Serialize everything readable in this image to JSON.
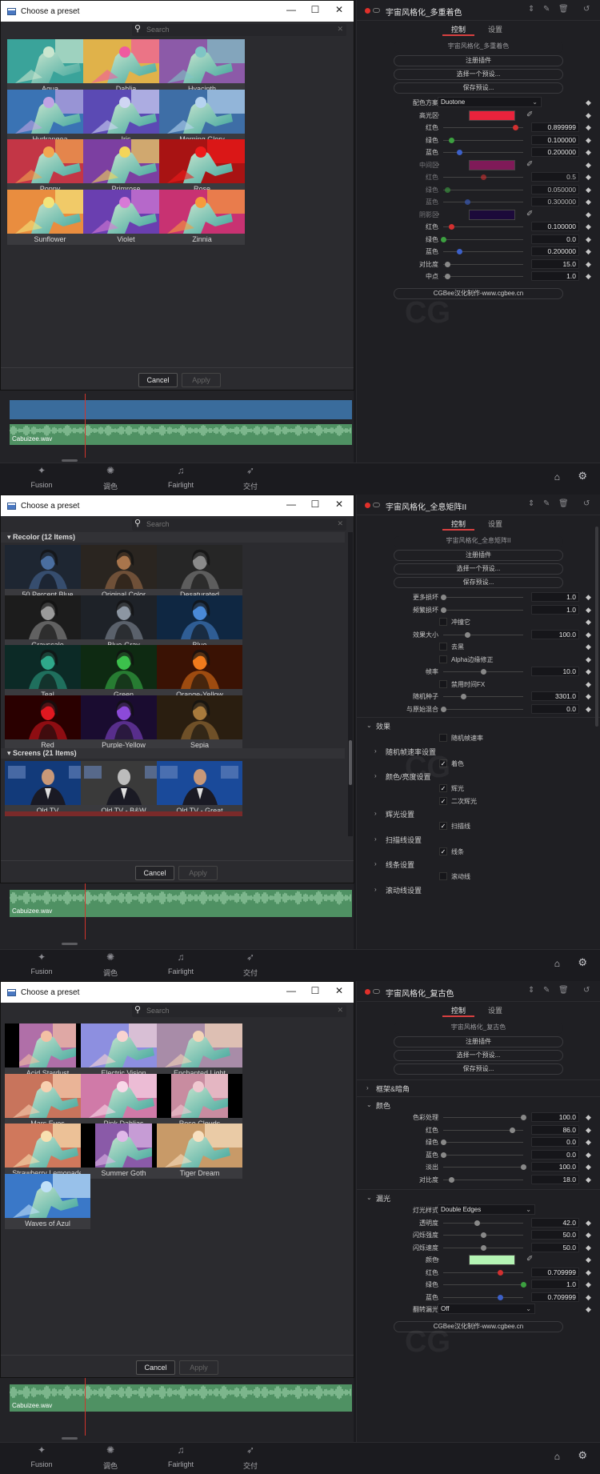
{
  "window_controls": {
    "minimize": "—",
    "maximize": "☐",
    "close": "✕"
  },
  "bottom_nav": {
    "fusion": "Fusion",
    "color": "调色",
    "fairlight": "Fairlight",
    "deliver": "交付"
  },
  "audio_clip_name": "Cabuizee.wav",
  "inspector_tabs": {
    "control": "控制",
    "settings": "设置"
  },
  "colors": {
    "accent_red": "#d84040",
    "panel_bg": "#1f1f23",
    "dialog_bg": "#2b2b2f",
    "audio_green": "#4f9163"
  },
  "icons": [
    "app-window-icon",
    "search-icon",
    "clear-icon",
    "minimize-icon",
    "maximize-icon",
    "close-icon",
    "fusion-icon",
    "color-icon",
    "fairlight-icon",
    "deliver-icon",
    "home-icon",
    "settings-gear-icon",
    "keyframe-diamond-icon",
    "eyedropper-icon",
    "chevron-right-icon",
    "chevron-down-icon",
    "undo-icon"
  ],
  "screens": [
    {
      "dialog": {
        "title": "Choose a preset",
        "search_placeholder": "Search",
        "cancel": "Cancel",
        "apply": "Apply"
      },
      "presets": [
        {
          "label": "Aqua",
          "c1": "#3aa39a",
          "c2": "#c9e6cf"
        },
        {
          "label": "Dahlia",
          "c1": "#e0b24a",
          "c2": "#f05aa0"
        },
        {
          "label": "Hyacinth",
          "c1": "#8c5aa8",
          "c2": "#7fc5c5"
        },
        {
          "label": "Hydrangea",
          "c1": "#3a73b4",
          "c2": "#c0a3e3"
        },
        {
          "label": "Iris",
          "c1": "#5b4ab4",
          "c2": "#cfd6f3"
        },
        {
          "label": "Morning Glory",
          "c1": "#3e6ea6",
          "c2": "#b6d3f0"
        },
        {
          "label": "Poppy",
          "c1": "#c33646",
          "c2": "#f2a64f"
        },
        {
          "label": "Primrose",
          "c1": "#7c3fa1",
          "c2": "#f3d55a"
        },
        {
          "label": "Rose",
          "c1": "#a81313",
          "c2": "#ef1a1a"
        },
        {
          "label": "Sunflower",
          "c1": "#e98d3f",
          "c2": "#f3e47b"
        },
        {
          "label": "Violet",
          "c1": "#6a3fb0",
          "c2": "#d77ad6"
        },
        {
          "label": "Zinnia",
          "c1": "#c83272",
          "c2": "#f79b3c"
        }
      ],
      "inspector": {
        "title": "宇宙风格化_多重着色",
        "effect_name": "宇宙风格化_多重着色",
        "register": "注册插件",
        "select_preset": "选择一个预设...",
        "save_preset": "保存预设...",
        "footer": "CGBee汉化制作-www.cgbee.cn",
        "scheme_label": "配色方案",
        "scheme_value": "Duotone",
        "params": [
          {
            "type": "swatch",
            "label": "高光区",
            "color": "#e9233c"
          },
          {
            "type": "slider",
            "label": "红色",
            "value": "0.899999",
            "pos": 0.9,
            "dot": "#d23030"
          },
          {
            "type": "slider",
            "label": "绿色",
            "value": "0.100000",
            "pos": 0.1,
            "dot": "#3ca040"
          },
          {
            "type": "slider",
            "label": "蓝色",
            "value": "0.200000",
            "pos": 0.2,
            "dot": "#3c60c8"
          },
          {
            "type": "swatch",
            "label": "中间区",
            "color": "#7f1a58",
            "dim": true
          },
          {
            "type": "slider",
            "label": "红色",
            "value": "0.5",
            "pos": 0.5,
            "dot": "#d23030",
            "dim": true
          },
          {
            "type": "slider",
            "label": "绿色",
            "value": "0.050000",
            "pos": 0.05,
            "dot": "#3ca040",
            "dim": true
          },
          {
            "type": "slider",
            "label": "蓝色",
            "value": "0.300000",
            "pos": 0.3,
            "dot": "#3c60c8",
            "dim": true
          },
          {
            "type": "swatch",
            "label": "阴影区",
            "color": "#1c0a3a",
            "dim": true
          },
          {
            "type": "slider",
            "label": "红色",
            "value": "0.100000",
            "pos": 0.1,
            "dot": "#d23030"
          },
          {
            "type": "slider",
            "label": "绿色",
            "value": "0.0",
            "pos": 0.0,
            "dot": "#3ca040"
          },
          {
            "type": "slider",
            "label": "蓝色",
            "value": "0.200000",
            "pos": 0.2,
            "dot": "#3c60c8"
          },
          {
            "type": "slider",
            "label": "对比度",
            "value": "15.0",
            "pos": 0.05,
            "dot": "#888888"
          },
          {
            "type": "slider",
            "label": "中点",
            "value": "1.0",
            "pos": 0.05,
            "dot": "#888888"
          }
        ]
      }
    },
    {
      "dialog": {
        "title": "Choose a preset",
        "search_placeholder": "Search",
        "cancel": "Cancel",
        "apply": "Apply"
      },
      "sections": [
        {
          "header": "Recolor (12 Items)",
          "presets": [
            {
              "label": "50 Percent Blue",
              "tint": "#4a6ea0",
              "bg": "#1e2632"
            },
            {
              "label": "Original Color",
              "tint": "#a8754c",
              "bg": "#2a2520"
            },
            {
              "label": "Desaturated",
              "tint": "#8a8a8a",
              "bg": "#262626"
            },
            {
              "label": "Grayscale",
              "tint": "#9a9a9a",
              "bg": "#1c1c1c"
            },
            {
              "label": "Blue-Gray",
              "tint": "#8c96a2",
              "bg": "#1e2228"
            },
            {
              "label": "Blue",
              "tint": "#4a8ad8",
              "bg": "#0f2742"
            },
            {
              "label": "Teal",
              "tint": "#2fa88a",
              "bg": "#0c2a26"
            },
            {
              "label": "Green",
              "tint": "#3cc04c",
              "bg": "#0e2a12"
            },
            {
              "label": "Orange-Yellow",
              "tint": "#f07a1c",
              "bg": "#3a1204"
            },
            {
              "label": "Red",
              "tint": "#e01820",
              "bg": "#2a0000"
            },
            {
              "label": "Purple-Yellow",
              "tint": "#8c4ad8",
              "bg": "#1a0c30"
            },
            {
              "label": "Sepia",
              "tint": "#a87a3c",
              "bg": "#2a1e10"
            }
          ]
        },
        {
          "header": "Screens (21 Items)",
          "presets": [
            {
              "label": "Old TV",
              "tint": "#c89878",
              "bg": "#123a7a"
            },
            {
              "label": "Old TV - B&W",
              "tint": "#bcbcbc",
              "bg": "#3a3a3a"
            },
            {
              "label": "Old TV - Great",
              "tint": "#c89878",
              "bg": "#1a4a9a"
            }
          ]
        }
      ],
      "inspector": {
        "title": "宇宙风格化_全息矩阵II",
        "effect_name": "宇宙风格化_全息矩阵II",
        "register": "注册插件",
        "select_preset": "选择一个预设...",
        "save_preset": "保存预设...",
        "params": [
          {
            "type": "slider",
            "label": "更多损坏",
            "value": "1.0",
            "pos": 0.0
          },
          {
            "type": "slider",
            "label": "频繁损坏",
            "value": "1.0",
            "pos": 0.0
          },
          {
            "type": "check",
            "label": "冲撞它",
            "checked": false
          },
          {
            "type": "slider",
            "label": "效果大小",
            "value": "100.0",
            "pos": 0.3
          },
          {
            "type": "check",
            "label": "去黑",
            "checked": false
          },
          {
            "type": "check",
            "label": "Alpha边缘修正",
            "checked": false
          },
          {
            "type": "slider",
            "label": "帧率",
            "value": "10.0",
            "pos": 0.5
          },
          {
            "type": "check",
            "label": "禁用时间FX",
            "checked": false
          },
          {
            "type": "slider",
            "label": "随机种子",
            "value": "3301.0",
            "pos": 0.25
          },
          {
            "type": "slider",
            "label": "与原始混合",
            "value": "0.0",
            "pos": 0.0
          }
        ],
        "groups": [
          {
            "type": "group",
            "label": "效果",
            "open": true
          },
          {
            "type": "check",
            "label": "随机帧速率",
            "checked": false
          },
          {
            "type": "subgroup",
            "label": "随机帧速率设置"
          },
          {
            "type": "check",
            "label": "着色",
            "checked": true
          },
          {
            "type": "subgroup",
            "label": "颜色/亮度设置"
          },
          {
            "type": "check",
            "label": "辉光",
            "checked": true
          },
          {
            "type": "check",
            "label": "二次辉光",
            "checked": true
          },
          {
            "type": "subgroup",
            "label": "辉光设置"
          },
          {
            "type": "check",
            "label": "扫描线",
            "checked": true
          },
          {
            "type": "subgroup",
            "label": "扫描线设置"
          },
          {
            "type": "check",
            "label": "线条",
            "checked": true
          },
          {
            "type": "subgroup",
            "label": "线条设置"
          },
          {
            "type": "check",
            "label": "滚动线",
            "checked": false
          },
          {
            "type": "subgroup",
            "label": "滚动线设置"
          }
        ]
      }
    },
    {
      "dialog": {
        "title": "Choose a preset",
        "search_placeholder": "Search",
        "cancel": "Cancel",
        "apply": "Apply"
      },
      "presets": [
        {
          "label": "Acid Stardust",
          "c1": "#b06fa8",
          "c2": "#f3c0a4",
          "bars": true
        },
        {
          "label": "Electric Vision",
          "c1": "#8d8fe0",
          "c2": "#f8d3d0",
          "bars": false
        },
        {
          "label": "Enchanted Light",
          "c1": "#a88ca8",
          "c2": "#f3d4b8",
          "bars": false
        },
        {
          "label": "Mars Eyes",
          "c1": "#c8745c",
          "c2": "#f8d0b0",
          "bars": false
        },
        {
          "label": "Pink Dahlias",
          "c1": "#d07aa8",
          "c2": "#f8d8e8",
          "bars": false
        },
        {
          "label": "Rose Clouds",
          "c1": "#c88ca0",
          "c2": "#f0c8d0",
          "bars": true
        },
        {
          "label": "Strawberry Lemonade",
          "c1": "#d0785c",
          "c2": "#f8e0b0",
          "bars": false
        },
        {
          "label": "Summer Goth",
          "c1": "#8a5aa8",
          "c2": "#e0b8e8",
          "bars": true
        },
        {
          "label": "Tiger Dream",
          "c1": "#c89a68",
          "c2": "#f8e0c0",
          "bars": false
        },
        {
          "label": "Waves of Azul",
          "c1": "#3a78c8",
          "c2": "#c0e0f8",
          "bars": false
        }
      ],
      "inspector": {
        "title": "宇宙风格化_复古色",
        "effect_name": "宇宙风格化_复古色",
        "register": "注册插件",
        "select_preset": "选择一个预设...",
        "save_preset": "保存预设...",
        "footer": "CGBee汉化制作-www.cgbee.cn",
        "group_frame": "框架&暗角",
        "group_color": "颜色",
        "group_leak": "漏光",
        "color_params": [
          {
            "type": "slider",
            "label": "色彩处理",
            "value": "100.0",
            "pos": 1.0
          },
          {
            "type": "slider",
            "label": "红色",
            "value": "86.0",
            "pos": 0.86
          },
          {
            "type": "slider",
            "label": "绿色",
            "value": "0.0",
            "pos": 0.0
          },
          {
            "type": "slider",
            "label": "蓝色",
            "value": "0.0",
            "pos": 0.0
          },
          {
            "type": "slider",
            "label": "淡出",
            "value": "100.0",
            "pos": 1.0
          },
          {
            "type": "slider",
            "label": "对比度",
            "value": "18.0",
            "pos": 0.1
          }
        ],
        "leak_style_label": "灯光样式",
        "leak_style_value": "Double Edges",
        "leak_params": [
          {
            "type": "slider",
            "label": "透明度",
            "value": "42.0",
            "pos": 0.42
          },
          {
            "type": "slider",
            "label": "闪烁强度",
            "value": "50.0",
            "pos": 0.5
          },
          {
            "type": "slider",
            "label": "闪烁速度",
            "value": "50.0",
            "pos": 0.5
          },
          {
            "type": "swatch",
            "label": "颜色",
            "color": "#b4f4b4"
          },
          {
            "type": "slider",
            "label": "红色",
            "value": "0.709999",
            "pos": 0.71,
            "dot": "#d23030"
          },
          {
            "type": "slider",
            "label": "绿色",
            "value": "1.0",
            "pos": 1.0,
            "dot": "#3ca040"
          },
          {
            "type": "slider",
            "label": "蓝色",
            "value": "0.709999",
            "pos": 0.71,
            "dot": "#3c60c8"
          }
        ],
        "flip_label": "翻转漏光",
        "flip_value": "Off"
      }
    }
  ]
}
